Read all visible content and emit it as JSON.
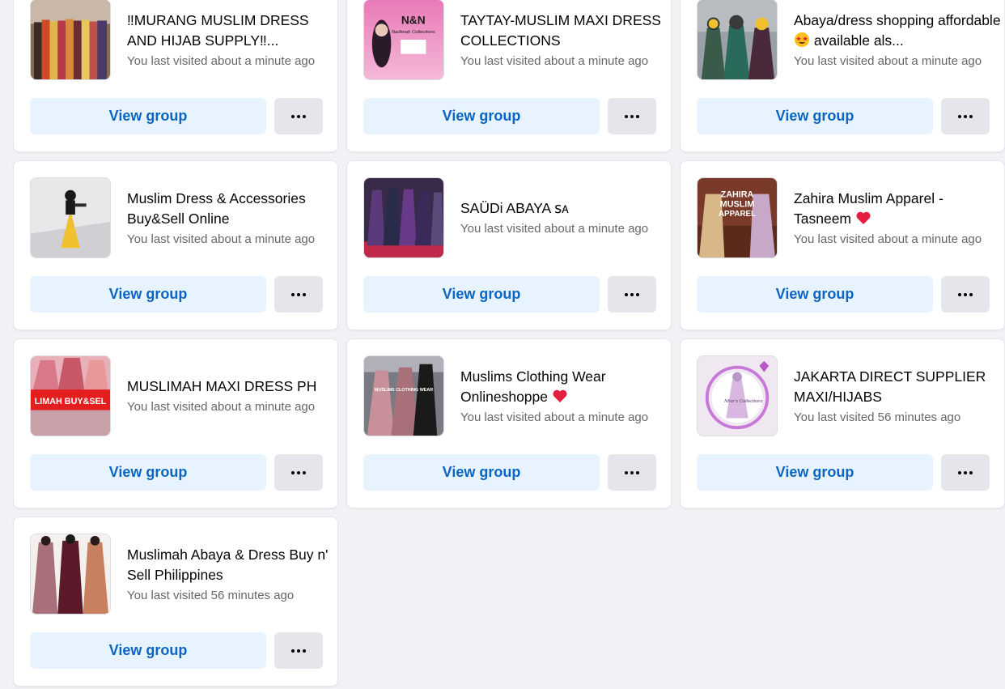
{
  "view_group_label": "View group",
  "groups": [
    {
      "title": "‼MURANG MUSLIM DRESS AND HIJAB SUPPLY‼...",
      "visited": "You last visited about a minute ago",
      "thumb_icon": "colorful-dresses-on-rack"
    },
    {
      "title": "TAYTAY-MUSLIM MAXI DRESS COLLECTIONS",
      "visited": "You last visited about a minute ago",
      "thumb_icon": "pink-logo-n-and-n"
    },
    {
      "title": "Abaya/dress shopping affordable",
      "title_suffix": "available als...",
      "visited": "You last visited about a minute ago",
      "thumb_icon": "women-in-abayas"
    },
    {
      "title": "Muslim Dress & Accessories Buy&Sell Online",
      "visited": "You last visited about a minute ago",
      "thumb_icon": "woman-yellow-dress"
    },
    {
      "title": "SAÜDi ABAYA ꜱᴀ",
      "visited": "You last visited about a minute ago",
      "thumb_icon": "abayas-on-mannequins"
    },
    {
      "title": "Zahira Muslim Apparel - Tasneem",
      "visited": "You last visited about a minute ago",
      "thumb_icon": "zahira-poster"
    },
    {
      "title": "MUSLIMAH MAXI DRESS PH",
      "visited": "You last visited about a minute ago",
      "thumb_icon": "pink-hijabs-banner"
    },
    {
      "title": "Muslims Clothing Wear Onlineshoppe",
      "visited": "You last visited about a minute ago",
      "thumb_icon": "pink-abayas"
    },
    {
      "title": "JAKARTA DIRECT SUPPLIER MAXI/HIJABS",
      "visited": "You last visited 56 minutes ago",
      "thumb_icon": "nhor-collections-logo"
    },
    {
      "title": "Muslimah Abaya & Dress Buy n' Sell Philippines",
      "visited": "You last visited 56 minutes ago",
      "thumb_icon": "three-abaya-dresses"
    }
  ],
  "thumb_texts": {
    "nn_logo": "N&N",
    "nn_sub": "Nadimah Collections",
    "zahira_head": "ZAHIRA",
    "zahira_mid": "MUSLIM",
    "zahira_tail": "APPAREL",
    "muslimah_banner": "LIMAH BUY&SEL",
    "clothing_overlay": "MUSLIMS CLOTHING WEAR",
    "nhor_logo": "Nhor's Collections"
  },
  "colors": {
    "button_bg": "#e7f3ff",
    "button_text": "#0a66c2",
    "more_bg": "#e4e6eb",
    "page_bg": "#f0f2f5",
    "heart": "#e41e3f"
  }
}
